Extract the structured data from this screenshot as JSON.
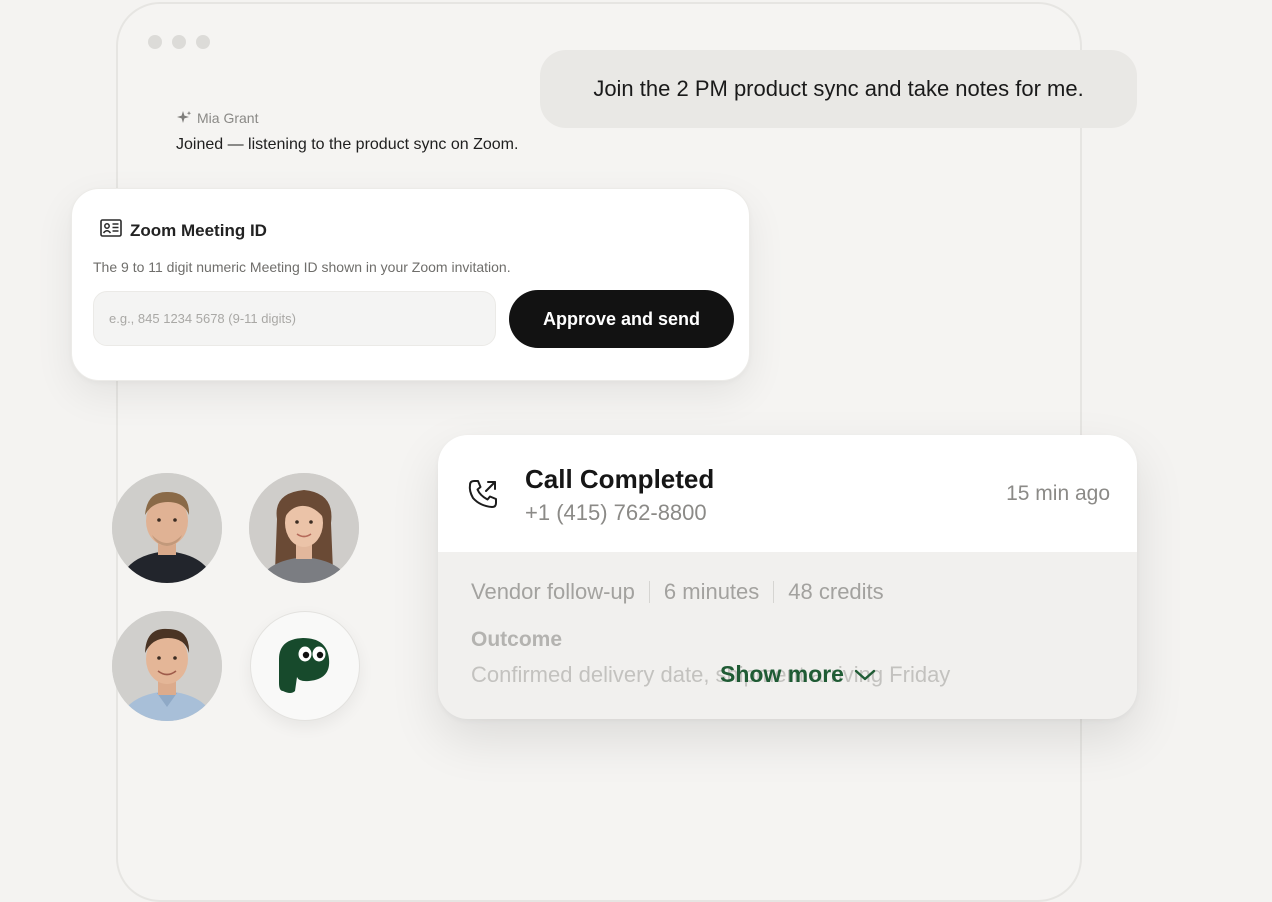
{
  "chat": {
    "user_message": "Join the 2 PM product sync and take notes for me.",
    "assistant_name": "Mia Grant",
    "assistant_message": "Joined — listening to the product sync on Zoom."
  },
  "zoom_card": {
    "title": "Zoom Meeting ID",
    "description": "The 9 to 11 digit numeric Meeting ID shown in your Zoom invitation.",
    "input_value": "",
    "input_placeholder": "e.g., 845 1234 5678 (9-11 digits)",
    "button_label": "Approve and send"
  },
  "call_card": {
    "title": "Call Completed",
    "phone": "+1 (415) 762-8800",
    "time": "15 min ago",
    "meta": [
      "Vendor follow-up",
      "6 minutes",
      "48 credits"
    ],
    "outcome_label": "Outcome",
    "outcome_text": "Confirmed delivery date, shipment arriving Friday",
    "show_more_label": "Show more"
  },
  "colors": {
    "accent_green": "#1f5b34",
    "button_dark": "#121212",
    "bubble_bg": "#e9e8e5",
    "page_bg": "#f4f3f1"
  },
  "icons": {
    "assistant": "sparkle-icon",
    "zoom_card": "id-card-icon",
    "call": "phone-outgoing-icon",
    "show_more": "chevron-down-icon",
    "mascot": "mascot-logo"
  }
}
